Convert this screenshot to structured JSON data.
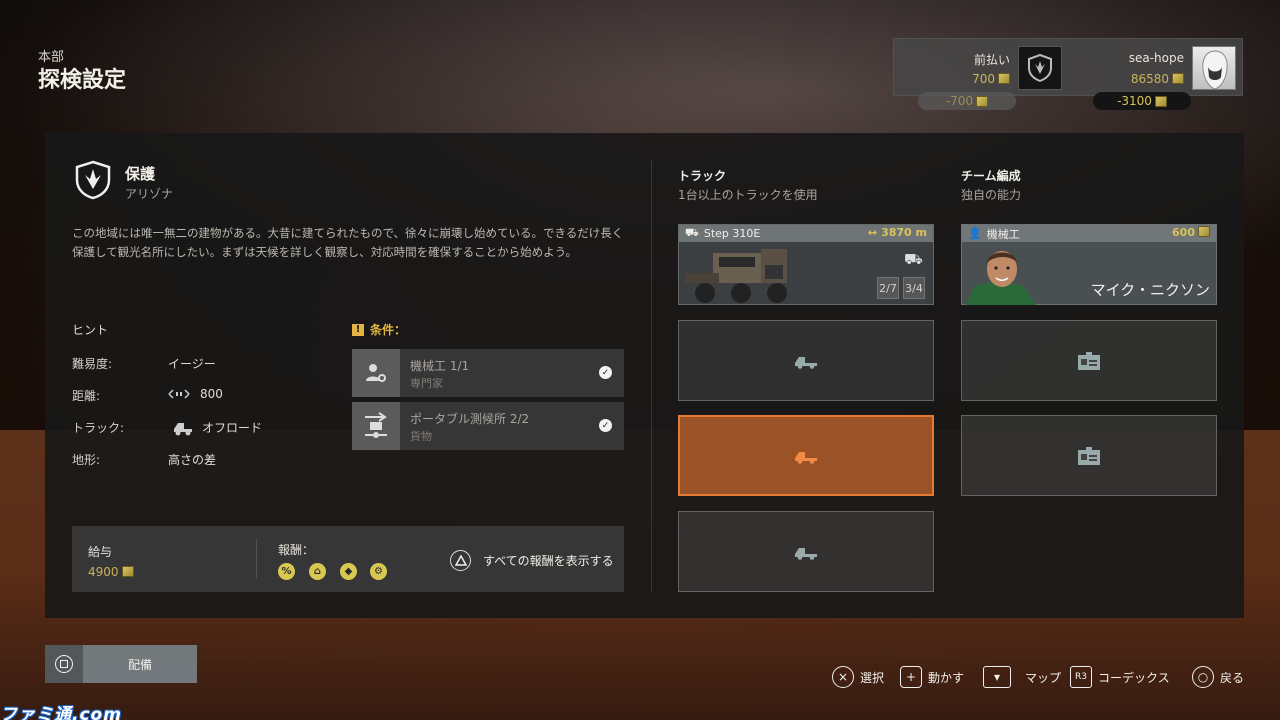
{
  "header": {
    "section": "本部",
    "title": "探検設定"
  },
  "wallet": {
    "prepay_label": "前払い",
    "prepay_amount": "700",
    "prepay_delta": "-700",
    "player_name": "sea-hope",
    "player_amount": "86580",
    "player_delta": "-3100"
  },
  "mission": {
    "title": "保護",
    "region": "アリゾナ",
    "description": "この地域には唯一無二の建物がある。大昔に建てられたもので、徐々に崩壊し始めている。できるだけ長く保護して観光名所にしたい。まずは天候を詳しく観察し、対応時間を確保することから始めよう。"
  },
  "hints": {
    "heading": "ヒント",
    "rows": [
      {
        "label": "難易度:",
        "value": "イージー"
      },
      {
        "label": "距離:",
        "value": "800"
      },
      {
        "label": "トラック:",
        "value": "オフロード"
      },
      {
        "label": "地形:",
        "value": "高さの差"
      }
    ]
  },
  "conditions": {
    "heading": "条件：",
    "items": [
      {
        "title": "機械工 1/1",
        "sub": "専門家"
      },
      {
        "title": "ポータブル測候所 2/2",
        "sub": "貨物"
      }
    ]
  },
  "pay": {
    "label": "給与",
    "value": "4900"
  },
  "rewards": {
    "label": "報酬：",
    "show_all": "すべての報酬を表示する",
    "icons": [
      "%",
      "⌂",
      "◆",
      "⚙"
    ]
  },
  "trucks": {
    "heading": "トラック",
    "sub": "1台以上のトラックを使用",
    "card": {
      "name": "Step 310E",
      "distance": "3870 m",
      "stat1": "2/7",
      "stat2": "3/4"
    }
  },
  "team": {
    "heading": "チーム編成",
    "sub": "独自の能力",
    "card": {
      "role": "機械工",
      "cost": "600",
      "name": "マイク・ニクソン"
    }
  },
  "deploy_label": "配備",
  "footer": [
    {
      "key": "×",
      "label": "選択"
    },
    {
      "key": "+",
      "label": "動かす"
    },
    {
      "key": "▾",
      "label": "マップ"
    },
    {
      "key": "R3",
      "label": "コーデックス"
    },
    {
      "key": "○",
      "label": "戻る"
    }
  ],
  "watermark": "ファミ通.com",
  "colors": {
    "accent_gold": "#d8c45a",
    "selected_orange": "#e57a35",
    "warning": "#e3b343"
  }
}
